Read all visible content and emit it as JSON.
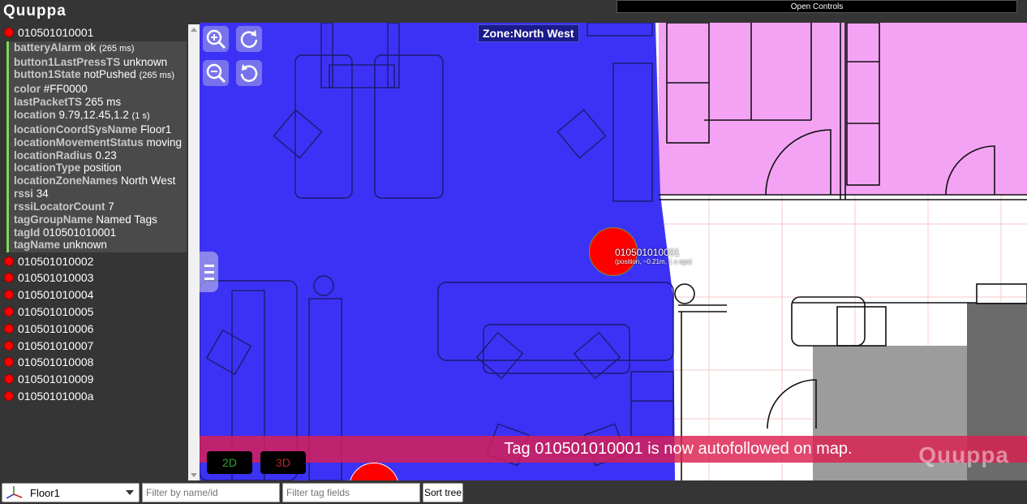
{
  "header": {
    "logo_text": "Quuppa",
    "open_controls_label": "Open Controls"
  },
  "tree": {
    "expanded_tag": {
      "id": "010501010001",
      "color": "#FF0000",
      "fields": [
        {
          "key": "batteryAlarm",
          "value": "ok",
          "time": "(265 ms)"
        },
        {
          "key": "button1LastPressTS",
          "value": "unknown",
          "time": ""
        },
        {
          "key": "button1State",
          "value": "notPushed",
          "time": "(265 ms)"
        },
        {
          "key": "color",
          "value": "#FF0000",
          "time": ""
        },
        {
          "key": "lastPacketTS",
          "value": "265 ms",
          "time": ""
        },
        {
          "key": "location",
          "value": "9.79,12.45,1.2",
          "time": "(1 s)"
        },
        {
          "key": "locationCoordSysName",
          "value": "Floor1",
          "time": ""
        },
        {
          "key": "locationMovementStatus",
          "value": "moving",
          "time": ""
        },
        {
          "key": "locationRadius",
          "value": "0.23",
          "time": ""
        },
        {
          "key": "locationType",
          "value": "position",
          "time": ""
        },
        {
          "key": "locationZoneNames",
          "value": "North West",
          "time": ""
        },
        {
          "key": "rssi",
          "value": "34",
          "time": ""
        },
        {
          "key": "rssiLocatorCount",
          "value": "7",
          "time": ""
        },
        {
          "key": "tagGroupName",
          "value": "Named Tags",
          "time": ""
        },
        {
          "key": "tagId",
          "value": "010501010001",
          "time": ""
        },
        {
          "key": "tagName",
          "value": "unknown",
          "time": ""
        }
      ]
    },
    "other_tags": [
      "010501010002",
      "010501010003",
      "010501010004",
      "010501010005",
      "010501010006",
      "010501010007",
      "010501010008",
      "010501010009",
      "01050101000a"
    ]
  },
  "map": {
    "zone_label": "Zone:North West",
    "marker_label": "010501010001",
    "marker_sublabel": "(position, ~0.21m, 1 s ago)",
    "toast": "Tag 010501010001 is now autofollowed on map.",
    "watermark": "Quuppa",
    "view_2d_label": "2D",
    "view_3d_label": "3D",
    "icons": [
      "zoom-in-icon",
      "rotate-cw-icon",
      "zoom-out-icon",
      "rotate-ccw-icon",
      "menu-icon"
    ]
  },
  "bottom": {
    "floor_value": "Floor1",
    "filter_name_placeholder": "Filter by name/id",
    "filter_fields_placeholder": "Filter tag fields",
    "sort_label": "Sort tree"
  }
}
